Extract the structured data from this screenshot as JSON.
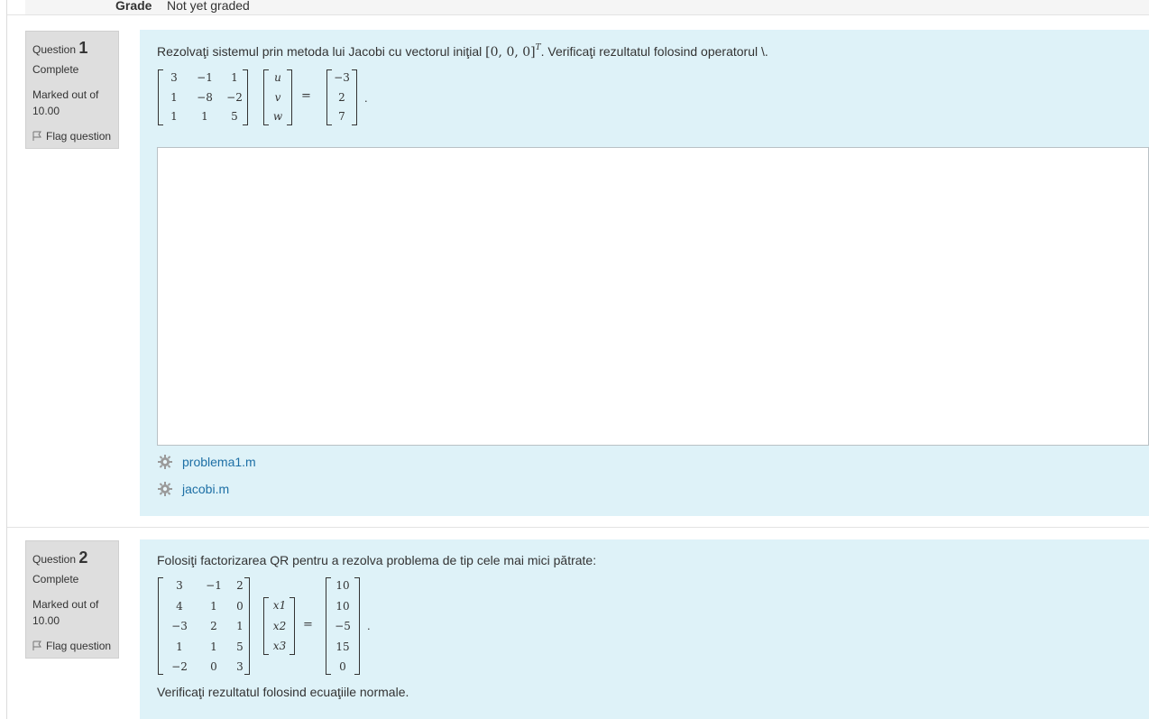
{
  "grade": {
    "label": "Grade",
    "value": "Not yet graded"
  },
  "questions": [
    {
      "label": "Question",
      "number": "1",
      "state": "Complete",
      "marked_label": "Marked out of",
      "marked_value": "10.00",
      "flag": "Flag question",
      "text_before": "Rezolvaţi sistemul prin metoda lui Jacobi cu vectorul iniţial ",
      "vector": "[0, 0, 0]",
      "vector_sup": "T",
      "text_after": ". Verificaţi rezultatul folosind operatorul \\.",
      "matrix": [
        [
          "3",
          "−1",
          "1"
        ],
        [
          "1",
          "−8",
          "−2"
        ],
        [
          "1",
          "1",
          "5"
        ]
      ],
      "unknowns": [
        "u",
        "v",
        "w"
      ],
      "rhs": [
        "−3",
        "2",
        "7"
      ],
      "equals": "=",
      "period": ".",
      "files": [
        {
          "name": "problema1.m",
          "icon": "gear-icon"
        },
        {
          "name": "jacobi.m",
          "icon": "gear-icon"
        }
      ]
    },
    {
      "label": "Question",
      "number": "2",
      "state": "Complete",
      "marked_label": "Marked out of",
      "marked_value": "10.00",
      "flag": "Flag question",
      "text": "Folosiţi factorizarea QR pentru a rezolva problema de tip cele mai mici pătrate:",
      "matrix": [
        [
          "3",
          "−1",
          "2"
        ],
        [
          "4",
          "1",
          "0"
        ],
        [
          "−3",
          "2",
          "1"
        ],
        [
          "1",
          "1",
          "5"
        ],
        [
          "−2",
          "0",
          "3"
        ]
      ],
      "unknowns": [
        "x1",
        "x2",
        "x3"
      ],
      "rhs": [
        "10",
        "10",
        "−5",
        "15",
        "0"
      ],
      "equals": "=",
      "period": ".",
      "text_after": "Verificaţi rezultatul folosind ecuaţiile normale."
    }
  ],
  "colors": {
    "info_bg": "#dedede",
    "content_bg": "#def2f8",
    "link": "#1d6fa5"
  }
}
